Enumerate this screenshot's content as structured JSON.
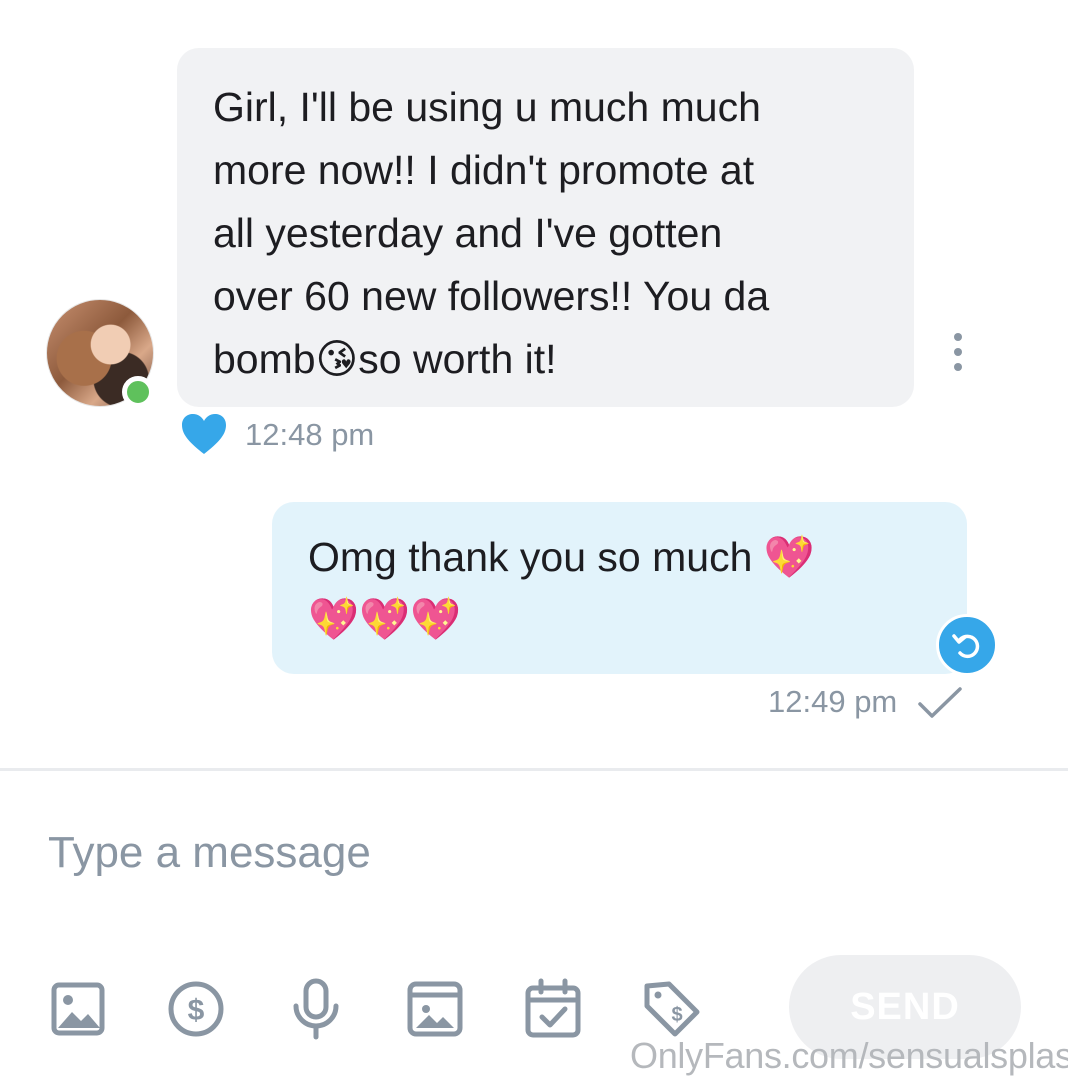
{
  "conversation": {
    "incoming": {
      "text": "Girl, I'll be using u much much\nmore now!! I didn't promote at\nall yesterday and I've gotten\nover 60 new followers!! You da\nbomb😘so worth it!",
      "time": "12:48 pm",
      "liked": true,
      "sender_online": true
    },
    "outgoing": {
      "text": "Omg thank you so much 💖\n💖💖💖",
      "time": "12:49 pm",
      "status": "sent"
    }
  },
  "composer": {
    "placeholder": "Type a message",
    "send_label": "SEND",
    "toolbar_icons": [
      "image-icon",
      "dollar-icon",
      "microphone-icon",
      "media-vault-icon",
      "calendar-icon",
      "price-tag-icon"
    ]
  },
  "watermark": "OnlyFans.com/sensualsplash",
  "colors": {
    "incoming_bubble": "#f1f2f4",
    "outgoing_bubble": "#e2f3fb",
    "accent_blue": "#36a7e9",
    "online_green": "#5fc15c",
    "muted_text": "#8a96a3"
  }
}
